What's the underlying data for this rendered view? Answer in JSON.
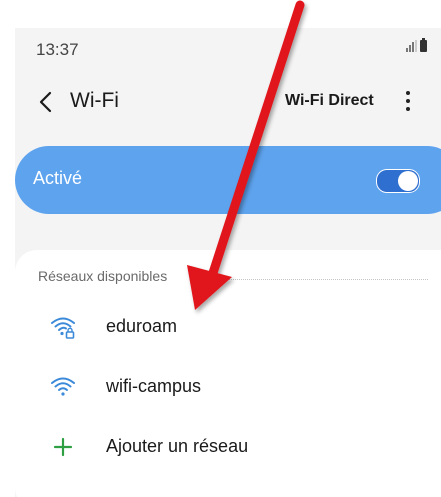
{
  "status_bar": {
    "time": "13:37"
  },
  "header": {
    "title": "Wi-Fi",
    "wifi_direct_label": "Wi-Fi Direct"
  },
  "wifi_toggle": {
    "label": "Activé",
    "state": "on"
  },
  "networks": {
    "section_title": "Réseaux disponibles",
    "items": [
      {
        "name": "eduroam",
        "icon": "wifi-secured-icon"
      },
      {
        "name": "wifi-campus",
        "icon": "wifi-icon"
      }
    ],
    "add_network_label": "Ajouter un réseau"
  },
  "colors": {
    "accent": "#5ea3ee",
    "wifi_icon": "#3b8ad9",
    "add_icon": "#2ea043",
    "annotation_arrow": "#e0161b"
  }
}
